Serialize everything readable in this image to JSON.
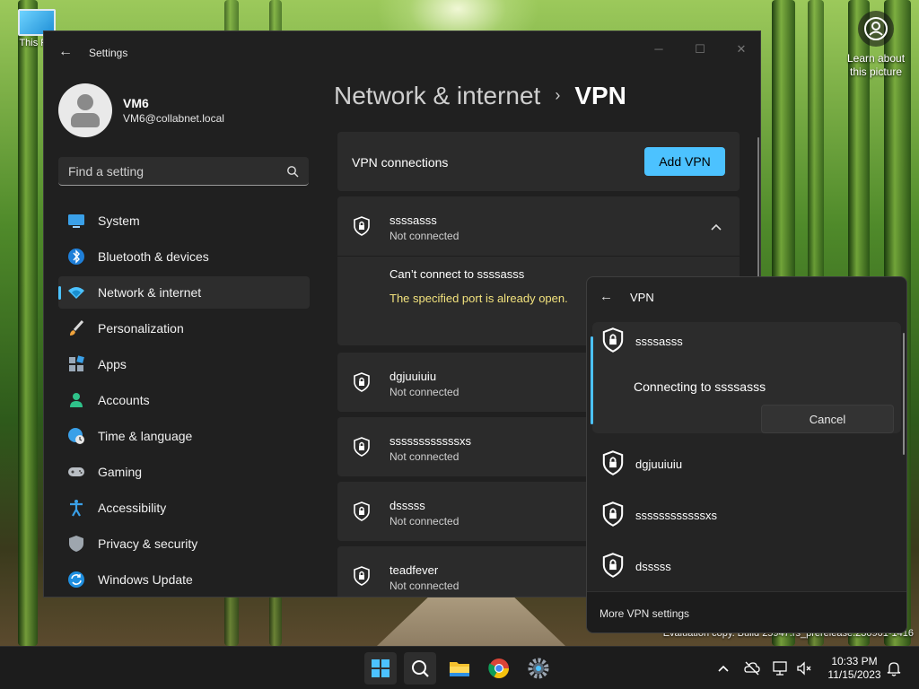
{
  "desktop": {
    "this_pc_label": "This PC",
    "learn_label": "Learn about this picture",
    "evaluation_text": "Evaluation copy. Build 25947.rs_prerelease.230901-1416"
  },
  "settings": {
    "app_title": "Settings",
    "profile": {
      "name": "VM6",
      "email": "VM6@collabnet.local"
    },
    "search_placeholder": "Find a setting",
    "nav": [
      {
        "label": "System",
        "icon": "system-icon"
      },
      {
        "label": "Bluetooth & devices",
        "icon": "bluetooth-icon"
      },
      {
        "label": "Network & internet",
        "icon": "wifi-icon",
        "active": true
      },
      {
        "label": "Personalization",
        "icon": "brush-icon"
      },
      {
        "label": "Apps",
        "icon": "apps-icon"
      },
      {
        "label": "Accounts",
        "icon": "accounts-icon"
      },
      {
        "label": "Time & language",
        "icon": "globe-clock-icon"
      },
      {
        "label": "Gaming",
        "icon": "gamepad-icon"
      },
      {
        "label": "Accessibility",
        "icon": "accessibility-icon"
      },
      {
        "label": "Privacy & security",
        "icon": "shield-icon"
      },
      {
        "label": "Windows Update",
        "icon": "update-icon"
      }
    ],
    "breadcrumb": {
      "parent": "Network & internet",
      "separator": "›",
      "current": "VPN"
    },
    "vpn_connections_label": "VPN connections",
    "add_vpn_label": "Add VPN",
    "expanded_vpn": {
      "name": "ssssasss",
      "status": "Not connected",
      "error_title": "Can’t connect to ssssasss",
      "error_detail": "The specified port is already open."
    },
    "vpn_list": [
      {
        "name": "dgjuuiuiu",
        "status": "Not connected"
      },
      {
        "name": "ssssssssssssxs",
        "status": "Not connected"
      },
      {
        "name": "dsssss",
        "status": "Not connected"
      },
      {
        "name": "teadfever",
        "status": "Not connected"
      }
    ]
  },
  "flyout": {
    "title": "VPN",
    "active": {
      "name": "ssssasss",
      "status": "Connecting to ssssasss",
      "cancel_label": "Cancel"
    },
    "items": [
      {
        "name": "dgjuuiuiu"
      },
      {
        "name": "ssssssssssssxs"
      },
      {
        "name": "dsssss"
      }
    ],
    "more_label": "More VPN settings"
  },
  "taskbar": {
    "apps": [
      "start-icon",
      "search-icon",
      "file-explorer-icon",
      "chrome-icon",
      "settings-icon"
    ],
    "time": "10:33 PM",
    "date": "11/15/2023"
  },
  "colors": {
    "accent": "#4cc2ff",
    "warning_text": "#f2e27d",
    "window_bg": "#202020",
    "card_bg": "#2b2b2b"
  }
}
